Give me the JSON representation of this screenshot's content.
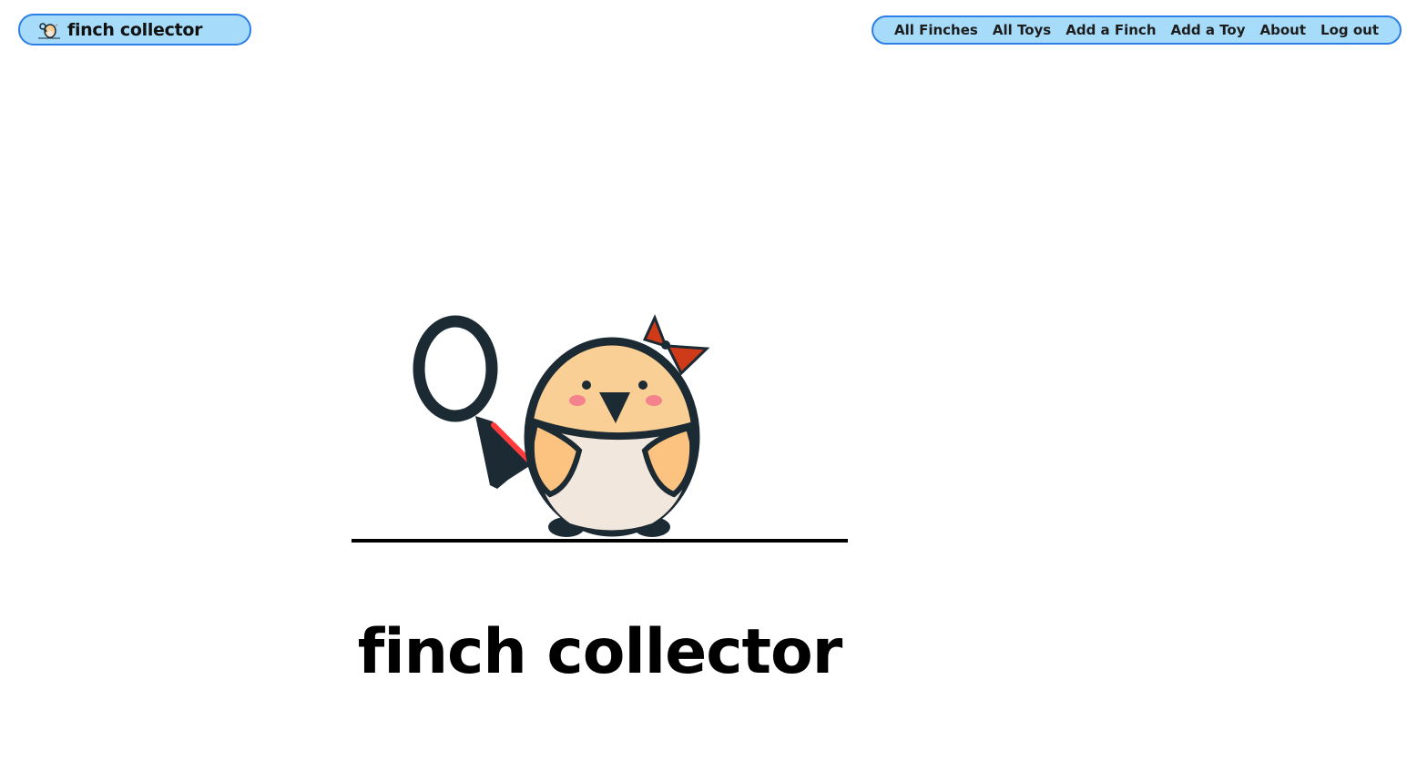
{
  "header": {
    "logo": {
      "icon": "finch-mascot-icon",
      "text": "finch collector"
    },
    "nav": {
      "links": [
        {
          "label": "All Finches"
        },
        {
          "label": "All Toys"
        },
        {
          "label": "Add a Finch"
        },
        {
          "label": "Add a Toy"
        },
        {
          "label": "About"
        },
        {
          "label": "Log out"
        }
      ]
    }
  },
  "hero": {
    "illustration": "finch-with-magnifying-glass-illustration",
    "title": "finch collector"
  },
  "colors": {
    "nav_background": "#a6dcf9",
    "nav_border": "#2d7ee6",
    "bird_body": "#f9cf96",
    "bird_belly": "#f2e7dc",
    "bird_outline": "#1b2a33",
    "bow": "#cf3b18"
  }
}
